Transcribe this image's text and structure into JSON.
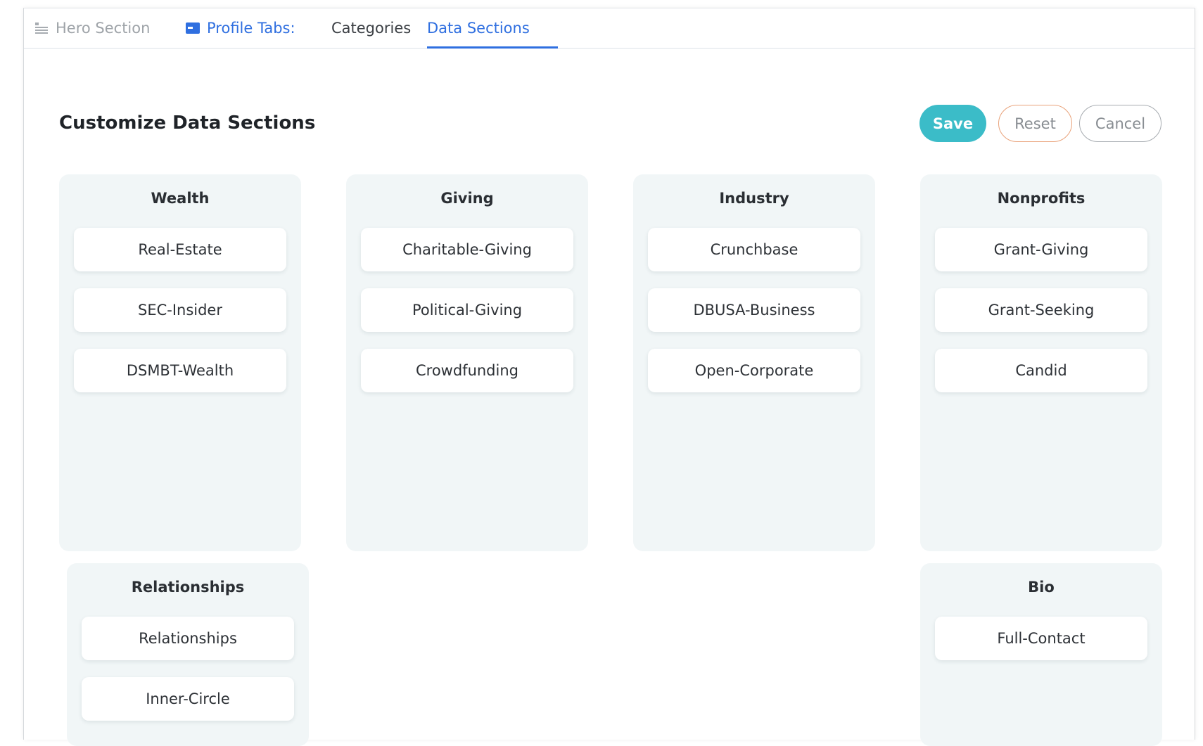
{
  "tabs": {
    "hero": "Hero Section",
    "profile": "Profile Tabs:",
    "categories": "Categories",
    "data_sections": "Data Sections"
  },
  "header": {
    "title": "Customize Data Sections"
  },
  "actions": {
    "save": "Save",
    "reset": "Reset",
    "cancel": "Cancel"
  },
  "colors": {
    "accent_blue": "#2f6fe0",
    "save_teal": "#3bbcc8",
    "reset_border": "#e9a27a",
    "card_bg": "#f1f6f7"
  },
  "icons": {
    "hero": "hero-section-icon",
    "profile": "profile-tabs-icon"
  },
  "sections": [
    {
      "title": "Wealth",
      "items": [
        "Real-Estate",
        "SEC-Insider",
        "DSMBT-Wealth"
      ]
    },
    {
      "title": "Giving",
      "items": [
        "Charitable-Giving",
        "Political-Giving",
        "Crowdfunding"
      ]
    },
    {
      "title": "Industry",
      "items": [
        "Crunchbase",
        "DBUSA-Business",
        "Open-Corporate"
      ]
    },
    {
      "title": "Nonprofits",
      "items": [
        "Grant-Giving",
        "Grant-Seeking",
        "Candid"
      ]
    },
    {
      "title": "Relationships",
      "items": [
        "Relationships",
        "Inner-Circle"
      ]
    },
    {
      "title": "Bio",
      "items": [
        "Full-Contact"
      ]
    }
  ]
}
